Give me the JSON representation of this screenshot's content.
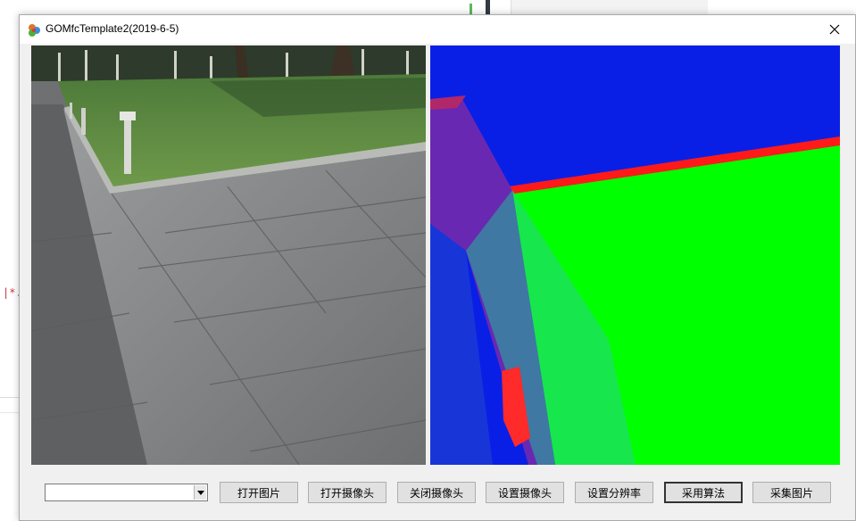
{
  "window": {
    "title": "GOMfcTemplate2(2019-6-5)",
    "icons": {
      "app": "app-icon",
      "close": "close-icon"
    }
  },
  "background": {
    "marker_text": "|*."
  },
  "images": {
    "left": "camera-photo-paved-walkway-and-lawn",
    "right": "segmentation-output-blue-green-red-overlay"
  },
  "controls": {
    "combo_value": "",
    "buttons": [
      {
        "label": "打开图片"
      },
      {
        "label": "打开摄像头"
      },
      {
        "label": "关闭摄像头"
      },
      {
        "label": "设置摄像头"
      },
      {
        "label": "设置分辨率"
      },
      {
        "label": "采用算法"
      },
      {
        "label": "采集图片"
      }
    ]
  },
  "colors": {
    "segmentation_sky": "#0a1fe6",
    "segmentation_ground": "#00ff00",
    "segmentation_edge": "#ff1a1a"
  }
}
